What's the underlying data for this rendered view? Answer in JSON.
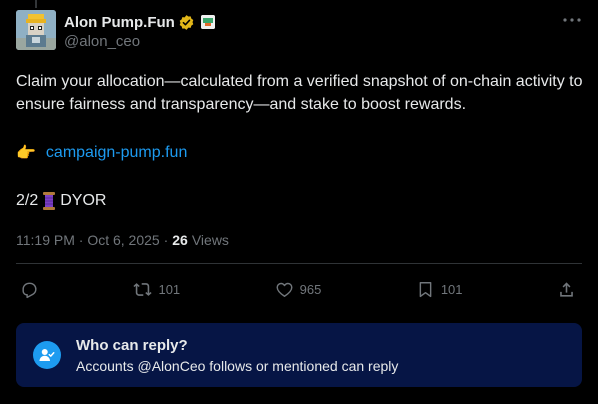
{
  "author": {
    "display_name": "Alon Pump.Fun",
    "handle": "@alon_ceo"
  },
  "post": {
    "text": "Claim your allocation—calculated from a verified snapshot of on-chain activity to ensure fairness and transparency—and stake to boost rewards.",
    "link_emoji": "👉",
    "link_text": "campaign-pump.fun",
    "footer_prefix": "2/2",
    "footer_suffix": "DYOR"
  },
  "meta": {
    "time": "11:19 PM · Oct 6, 2025 ·",
    "views_count": "26",
    "views_label": "Views"
  },
  "actions": {
    "reposts": "101",
    "likes": "965",
    "bookmarks": "101"
  },
  "reply_restriction": {
    "title": "Who can reply?",
    "subtitle": "Accounts @AlonCeo follows or mentioned can reply"
  },
  "colors": {
    "background": "#000000",
    "accent": "#1d9bf0",
    "verified_gold": "#e2b719",
    "reply_box": "#061545"
  },
  "icons": [
    "more-icon",
    "verified-icon",
    "affiliate-badge-icon",
    "pointing-hand-icon",
    "thread-spool-icon",
    "reply-icon",
    "repost-icon",
    "like-icon",
    "bookmark-icon",
    "share-icon",
    "reply-restriction-icon"
  ]
}
